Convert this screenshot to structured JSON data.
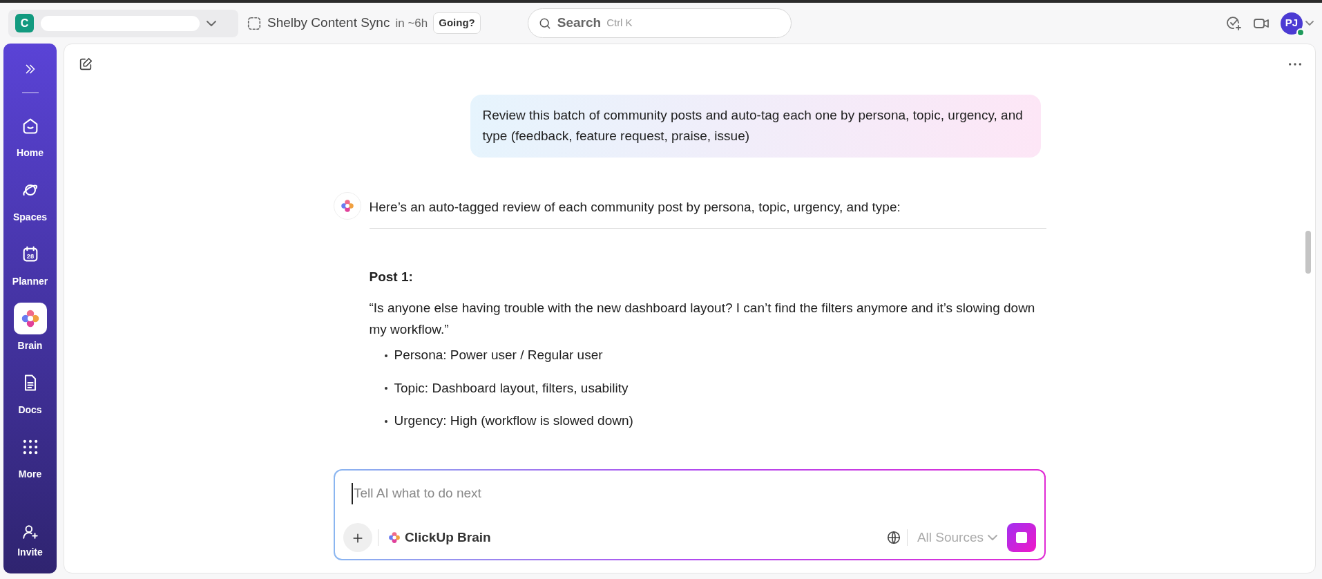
{
  "topbar": {
    "workspace": {
      "initial": "C"
    },
    "event": {
      "title": "Shelby Content Sync",
      "time": "in ~6h",
      "rsvp": "Going?"
    },
    "search": {
      "placeholder": "Search",
      "shortcut": "Ctrl K"
    },
    "user": {
      "initials": "PJ",
      "online": true
    }
  },
  "sidebar": {
    "items": [
      {
        "label": "Home",
        "kind": "home",
        "selected": false
      },
      {
        "label": "Spaces",
        "kind": "spaces",
        "selected": false
      },
      {
        "label": "Planner",
        "kind": "planner",
        "icon_text": "28",
        "selected": false
      },
      {
        "label": "Brain",
        "kind": "brain",
        "selected": true
      },
      {
        "label": "Docs",
        "kind": "docs",
        "selected": false
      },
      {
        "label": "More",
        "kind": "more",
        "selected": false
      }
    ],
    "invite": "Invite"
  },
  "chat": {
    "user_message": "Review this batch of community posts and auto-tag each one by persona, topic, urgency, and type (feedback, feature request, praise, issue)",
    "reply": {
      "intro": "Here’s an auto-tagged review of each community post by persona, topic, urgency, and type:",
      "posts": [
        {
          "heading": "Post 1:",
          "quote": "“Is anyone else having trouble with the new dashboard layout? I can’t find the filters anymore and it’s slowing down my workflow.”",
          "tags": [
            "Persona: Power user / Regular user",
            "Topic: Dashboard layout, filters, usability",
            "Urgency: High (workflow is slowed down)"
          ]
        }
      ]
    }
  },
  "composer": {
    "placeholder": "Tell AI what to do next",
    "agent": "ClickUp Brain",
    "sources": "All Sources"
  }
}
